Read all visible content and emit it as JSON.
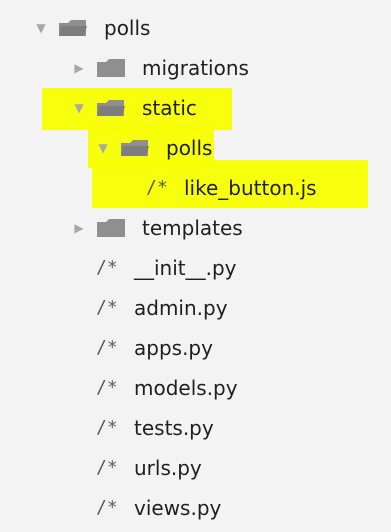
{
  "explorer": {
    "polls": "polls",
    "migrations": "migrations",
    "static": "static",
    "static_polls": "polls",
    "like_button": "like_button.js",
    "templates": "templates",
    "init": "__init__.py",
    "admin": "admin.py",
    "apps": "apps.py",
    "models": "models.py",
    "tests": "tests.py",
    "urls": "urls.py",
    "views": "views.py",
    "file_icon_text": "/*"
  },
  "colors": {
    "highlight": "#f7ff00",
    "folder": "#8f8f8f",
    "arrow": "#a7a7a7",
    "text": "#1f1f1f",
    "background": "#f3f3f3"
  }
}
